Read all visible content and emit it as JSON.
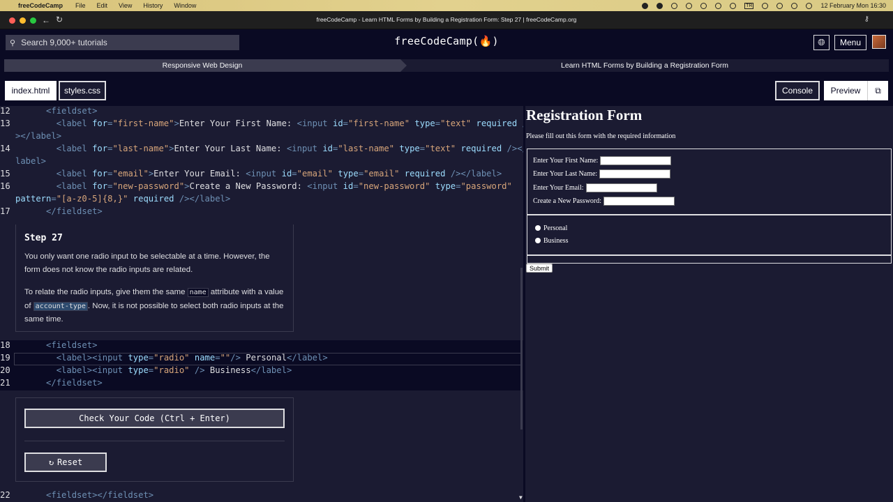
{
  "mac_menubar": {
    "app_name": "freeCodeCamp",
    "menus": [
      "File",
      "Edit",
      "View",
      "History",
      "Window"
    ],
    "input_source": "TR",
    "datetime": "12 February Mon  16:30"
  },
  "window": {
    "title": "freeCodeCamp - Learn HTML Forms by Building a Registration Form: Step 27 | freeCodeCamp.org"
  },
  "nav": {
    "search_placeholder": "Search 9,000+ tutorials",
    "brand": "freeCodeCamp(🔥)",
    "menu_label": "Menu"
  },
  "breadcrumb": {
    "superblock": "Responsive Web Design",
    "block": "Learn HTML Forms by Building a Registration Form"
  },
  "tabs": {
    "index": "index.html",
    "styles": "styles.css",
    "console": "Console",
    "preview": "Preview"
  },
  "editor": {
    "lines": [
      {
        "n": "12",
        "html": "<span class='txt'>      </span><span class='tag'>&lt;fieldset&gt;</span>"
      },
      {
        "n": "13",
        "html": "<span class='txt'>        </span><span class='tag'>&lt;label </span><span class='attr'>for</span><span class='tag'>=</span><span class='str'>\"first-name\"</span><span class='tag'>&gt;</span><span class='txt'>Enter Your First Name: </span><span class='tag'>&lt;input </span><span class='attr'>id</span><span class='tag'>=</span><span class='str'>\"first-name\"</span><span class='txt'> </span><span class='attr'>type</span><span class='tag'>=</span><span class='str'>\"text\"</span><span class='txt'> </span><span class='attr'>required</span><span class='tag'> /</span>"
      },
      {
        "n": "",
        "html": "<span class='tag'>&gt;&lt;/label&gt;</span>"
      },
      {
        "n": "14",
        "html": "<span class='txt'>        </span><span class='tag'>&lt;label </span><span class='attr'>for</span><span class='tag'>=</span><span class='str'>\"last-name\"</span><span class='tag'>&gt;</span><span class='txt'>Enter Your Last Name: </span><span class='tag'>&lt;input </span><span class='attr'>id</span><span class='tag'>=</span><span class='str'>\"last-name\"</span><span class='txt'> </span><span class='attr'>type</span><span class='tag'>=</span><span class='str'>\"text\"</span><span class='txt'> </span><span class='attr'>required</span><span class='tag'> /&gt;&lt;/</span>"
      },
      {
        "n": "",
        "html": "<span class='tag'>label&gt;</span>"
      },
      {
        "n": "15",
        "html": "<span class='txt'>        </span><span class='tag'>&lt;label </span><span class='attr'>for</span><span class='tag'>=</span><span class='str'>\"email\"</span><span class='tag'>&gt;</span><span class='txt'>Enter Your Email: </span><span class='tag'>&lt;input </span><span class='attr'>id</span><span class='tag'>=</span><span class='str'>\"email\"</span><span class='txt'> </span><span class='attr'>type</span><span class='tag'>=</span><span class='str'>\"email\"</span><span class='txt'> </span><span class='attr'>required</span><span class='tag'> /&gt;&lt;/label&gt;</span>"
      },
      {
        "n": "16",
        "html": "<span class='txt'>        </span><span class='tag'>&lt;label </span><span class='attr'>for</span><span class='tag'>=</span><span class='str'>\"new-password\"</span><span class='tag'>&gt;</span><span class='txt'>Create a New Password: </span><span class='tag'>&lt;input </span><span class='attr'>id</span><span class='tag'>=</span><span class='str'>\"new-password\"</span><span class='txt'> </span><span class='attr'>type</span><span class='tag'>=</span><span class='str'>\"password\"</span>"
      },
      {
        "n": "",
        "html": "<span class='attr'>pattern</span><span class='tag'>=</span><span class='str'>\"[a-z0-5]{8,}\"</span><span class='txt'> </span><span class='attr'>required</span><span class='tag'> /&gt;&lt;/label&gt;</span>"
      },
      {
        "n": "17",
        "html": "<span class='txt'>      </span><span class='tag'>&lt;/fieldset&gt;</span>"
      }
    ],
    "lines_bottom": [
      {
        "n": "18",
        "html": "<span class='txt'>      </span><span class='tag'>&lt;fieldset&gt;</span>"
      },
      {
        "n": "19",
        "html": "<span class='txt'>        </span><span class='tag'>&lt;label&gt;&lt;input </span><span class='attr'>type</span><span class='tag'>=</span><span class='str'>\"radio\"</span><span class='txt'> </span><span class='attr'>name</span><span class='tag'>=</span><span class='str'>\"\"</span><span class='tag'>/&gt;</span><span class='txt'> Personal</span><span class='tag'>&lt;/label&gt;</span>"
      },
      {
        "n": "20",
        "html": "<span class='txt'>        </span><span class='tag'>&lt;label&gt;&lt;input </span><span class='attr'>type</span><span class='tag'>=</span><span class='str'>\"radio\"</span><span class='tag'> /&gt;</span><span class='txt'> Business</span><span class='tag'>&lt;/label&gt;</span>"
      },
      {
        "n": "21",
        "html": "<span class='txt'>      </span><span class='tag'>&lt;/fieldset&gt;</span>"
      }
    ],
    "last_line": {
      "n": "22",
      "html": "<span class='txt'>      </span><span class='tag'>&lt;fieldset&gt;&lt;/fieldset&gt;</span>"
    }
  },
  "instructions": {
    "step_title": "Step 27",
    "para1": "You only want one radio input to be selectable at a time. However, the form does not know the radio inputs are related.",
    "para2_a": "To relate the radio inputs, give them the same ",
    "para2_code1": "name",
    "para2_b": " attribute with a value of ",
    "para2_code2": "account-type",
    "para2_c": ". Now, it is not possible to select both radio inputs at the same time."
  },
  "actions": {
    "check_label": "Check Your Code (Ctrl + Enter)",
    "reset_label": "Reset"
  },
  "preview": {
    "title": "Registration Form",
    "subtitle": "Please fill out this form with the required information",
    "fields": [
      "Enter Your First Name:",
      "Enter Your Last Name:",
      "Enter Your Email:",
      "Create a New Password:"
    ],
    "radios": [
      "Personal",
      "Business"
    ],
    "submit": "Submit"
  }
}
